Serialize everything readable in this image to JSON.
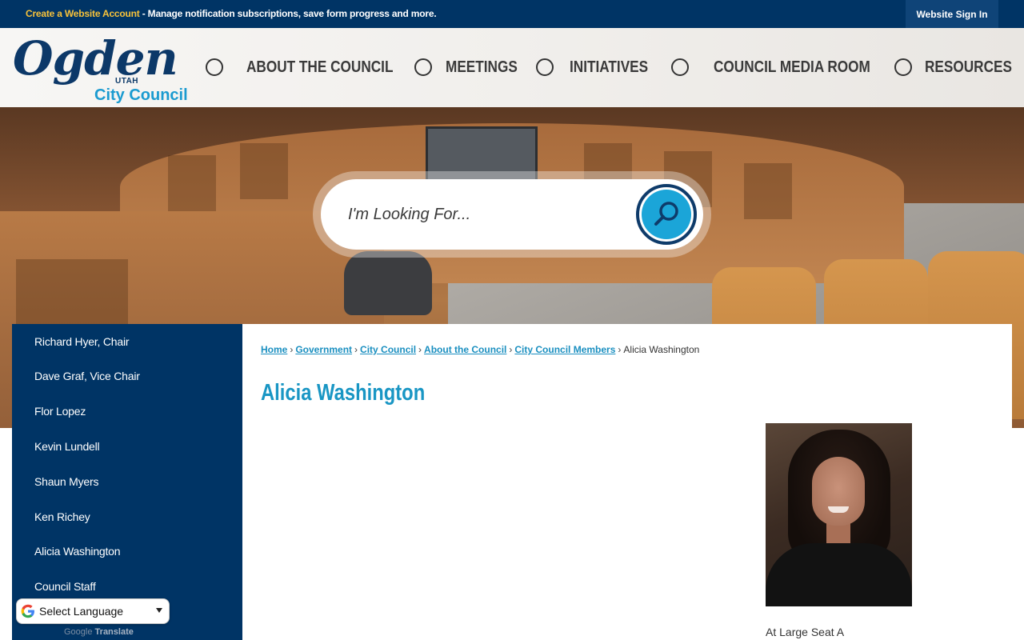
{
  "topbar": {
    "create_link": "Create a Website Account",
    "message": " - Manage notification subscriptions, save form progress and more.",
    "signin_label": "Website Sign In"
  },
  "logo": {
    "name": "Ogden",
    "state": "UTAH",
    "subtitle": "City Council"
  },
  "nav": {
    "items": [
      {
        "label": "ABOUT THE COUNCIL"
      },
      {
        "label": "MEETINGS"
      },
      {
        "label": "INITIATIVES"
      },
      {
        "label": "COUNCIL MEDIA ROOM"
      },
      {
        "label": "RESOURCES"
      }
    ]
  },
  "search": {
    "placeholder": "I'm Looking For...",
    "icon": "magnifier-icon"
  },
  "sidebar": {
    "items": [
      {
        "label": "Richard Hyer, Chair"
      },
      {
        "label": "Dave Graf, Vice Chair"
      },
      {
        "label": "Flor Lopez"
      },
      {
        "label": "Kevin Lundell"
      },
      {
        "label": "Shaun Myers"
      },
      {
        "label": "Ken Richey"
      },
      {
        "label": "Alicia Washington"
      },
      {
        "label": "Council Staff"
      }
    ]
  },
  "translate": {
    "label": "Select Language",
    "powered_by": "Google",
    "powered_word": "Translate"
  },
  "breadcrumb": {
    "items": [
      {
        "label": "Home"
      },
      {
        "label": "Government"
      },
      {
        "label": "City Council"
      },
      {
        "label": "About the Council"
      },
      {
        "label": "City Council Members"
      }
    ],
    "current": "Alicia Washington",
    "separator": "›"
  },
  "page": {
    "title": "Alicia Washington",
    "seat": "At Large Seat A"
  },
  "colors": {
    "navy": "#003465",
    "accent_blue": "#1996c4",
    "gold": "#f7c23a"
  }
}
